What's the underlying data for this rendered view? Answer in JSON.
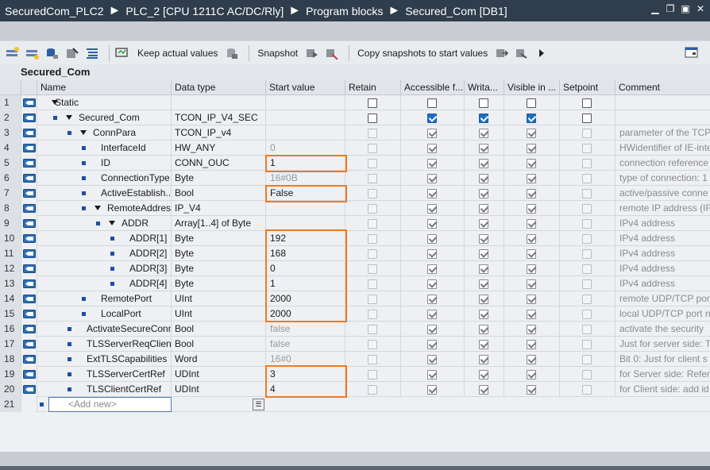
{
  "title_bar": {
    "crumbs": [
      "SecuredCom_PLC2",
      "PLC_2 [CPU 1211C AC/DC/Rly]",
      "Program blocks",
      "Secured_Com [DB1]"
    ],
    "separator": "►"
  },
  "toolbar": {
    "keep_actual_label": "Keep actual values",
    "snapshot_label": "Snapshot",
    "copy_snapshots_label": "Copy snapshots to start values"
  },
  "block_title": "Secured_Com",
  "columns": {
    "name": "Name",
    "data_type": "Data type",
    "start_value": "Start value",
    "retain": "Retain",
    "accessible": "Accessible f...",
    "writable": "Writa...",
    "visible": "Visible in ...",
    "setpoint": "Setpoint",
    "comment": "Comment"
  },
  "rows": [
    {
      "n": "1",
      "name": "Static",
      "type": "",
      "value": "",
      "value_grey": false,
      "comment": "",
      "level": 0,
      "expand": true,
      "bullet": false,
      "checks": "dark"
    },
    {
      "n": "2",
      "name": "Secured_Com",
      "type": "TCON_IP_V4_SEC",
      "value": "",
      "value_grey": false,
      "comment": "",
      "level": 1,
      "expand": true,
      "bullet": true,
      "checks": "blue"
    },
    {
      "n": "3",
      "name": "ConnPara",
      "type": "TCON_IP_v4",
      "value": "",
      "value_grey": false,
      "comment": "parameter of the TCP",
      "level": 2,
      "expand": true,
      "bullet": true,
      "checks": "grey"
    },
    {
      "n": "4",
      "name": "InterfaceId",
      "type": "HW_ANY",
      "value": "0",
      "value_grey": true,
      "comment": "HWidentifier of IE-inte",
      "level": 3,
      "expand": false,
      "bullet": true,
      "checks": "grey"
    },
    {
      "n": "5",
      "name": "ID",
      "type": "CONN_OUC",
      "value": "1",
      "value_grey": false,
      "comment": "connection reference",
      "level": 3,
      "expand": false,
      "bullet": true,
      "checks": "grey"
    },
    {
      "n": "6",
      "name": "ConnectionType",
      "type": "Byte",
      "value": "16#0B",
      "value_grey": true,
      "comment": "type of connection: 1",
      "level": 3,
      "expand": false,
      "bullet": true,
      "checks": "grey"
    },
    {
      "n": "7",
      "name": "ActiveEstablish...",
      "type": "Bool",
      "value": "False",
      "value_grey": false,
      "comment": "active/passive conne",
      "level": 3,
      "expand": false,
      "bullet": true,
      "checks": "grey"
    },
    {
      "n": "8",
      "name": "RemoteAddress",
      "type": "IP_V4",
      "value": "",
      "value_grey": false,
      "comment": "remote IP address (IF",
      "level": 3,
      "expand": true,
      "bullet": true,
      "checks": "grey"
    },
    {
      "n": "9",
      "name": "ADDR",
      "type": "Array[1..4] of Byte",
      "value": "",
      "value_grey": false,
      "comment": "IPv4 address",
      "level": 4,
      "expand": true,
      "bullet": true,
      "checks": "grey"
    },
    {
      "n": "10",
      "name": "ADDR[1]",
      "type": "Byte",
      "value": "192",
      "value_grey": false,
      "comment": "IPv4 address",
      "level": 5,
      "expand": false,
      "bullet": true,
      "checks": "grey"
    },
    {
      "n": "11",
      "name": "ADDR[2]",
      "type": "Byte",
      "value": "168",
      "value_grey": false,
      "comment": "IPv4 address",
      "level": 5,
      "expand": false,
      "bullet": true,
      "checks": "grey"
    },
    {
      "n": "12",
      "name": "ADDR[3]",
      "type": "Byte",
      "value": "0",
      "value_grey": false,
      "comment": "IPv4 address",
      "level": 5,
      "expand": false,
      "bullet": true,
      "checks": "grey"
    },
    {
      "n": "13",
      "name": "ADDR[4]",
      "type": "Byte",
      "value": "1",
      "value_grey": false,
      "comment": "IPv4 address",
      "level": 5,
      "expand": false,
      "bullet": true,
      "checks": "grey"
    },
    {
      "n": "14",
      "name": "RemotePort",
      "type": "UInt",
      "value": "2000",
      "value_grey": false,
      "comment": "remote UDP/TCP port",
      "level": 3,
      "expand": false,
      "bullet": true,
      "checks": "grey"
    },
    {
      "n": "15",
      "name": "LocalPort",
      "type": "UInt",
      "value": "2000",
      "value_grey": false,
      "comment": "local UDP/TCP port nu",
      "level": 3,
      "expand": false,
      "bullet": true,
      "checks": "grey"
    },
    {
      "n": "16",
      "name": "ActivateSecureConn",
      "type": "Bool",
      "value": "false",
      "value_grey": true,
      "comment": "activate the security",
      "level": 2,
      "expand": false,
      "bullet": true,
      "checks": "grey"
    },
    {
      "n": "17",
      "name": "TLSServerReqClient...",
      "type": "Bool",
      "value": "false",
      "value_grey": true,
      "comment": "Just for server side: T",
      "level": 2,
      "expand": false,
      "bullet": true,
      "checks": "grey"
    },
    {
      "n": "18",
      "name": "ExtTLSCapabilities",
      "type": "Word",
      "value": "16#0",
      "value_grey": true,
      "comment": "Bit 0: Just for client s",
      "level": 2,
      "expand": false,
      "bullet": true,
      "checks": "grey"
    },
    {
      "n": "19",
      "name": "TLSServerCertRef",
      "type": "UDInt",
      "value": "3",
      "value_grey": false,
      "comment": "for Server side: Refer",
      "level": 2,
      "expand": false,
      "bullet": true,
      "checks": "grey"
    },
    {
      "n": "20",
      "name": "TLSClientCertRef",
      "type": "UDInt",
      "value": "4",
      "value_grey": false,
      "comment": "for Client side: add id",
      "level": 2,
      "expand": false,
      "bullet": true,
      "checks": "grey"
    }
  ],
  "add_new": {
    "row_number": "21",
    "placeholder": "<Add new>"
  },
  "colors": {
    "highlight": "#f07a1f",
    "checkbox_blue": "#1f6dc4",
    "title_bar": "#2f3d4c"
  }
}
